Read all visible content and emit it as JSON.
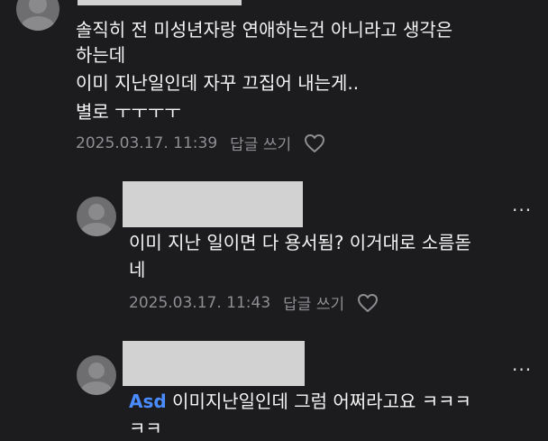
{
  "comments": [
    {
      "lines": [
        "솔직히 전 미성년자랑 연애하는건 아니라고 생각은",
        "하는데",
        "이미 지난일인데 자꾸 끄집어 내는게..",
        "별로 ㅜㅜㅜㅜ"
      ],
      "timestamp": "2025.03.17. 11:39",
      "reply_label": "답글 쓰기",
      "like_icon": "heart-outline-icon"
    },
    {
      "lines": [
        "이미 지난 일이면 다 용서됨? 이거대로 소름돋",
        "네"
      ],
      "timestamp": "2025.03.17. 11:43",
      "reply_label": "답글 쓰기",
      "like_icon": "heart-outline-icon",
      "more_label": "···"
    },
    {
      "mention": "Asd",
      "lines": [
        " 이미지난일인데 그럼 어쩌라고요 ㅋㅋㅋ",
        "ㅋㅋ"
      ],
      "more_label": "···"
    }
  ],
  "colors": {
    "background": "#1c1c1e",
    "text": "#f4f4f4",
    "meta": "#8e8e93",
    "mention": "#4a8cff",
    "redaction": "#d2d2d2"
  }
}
